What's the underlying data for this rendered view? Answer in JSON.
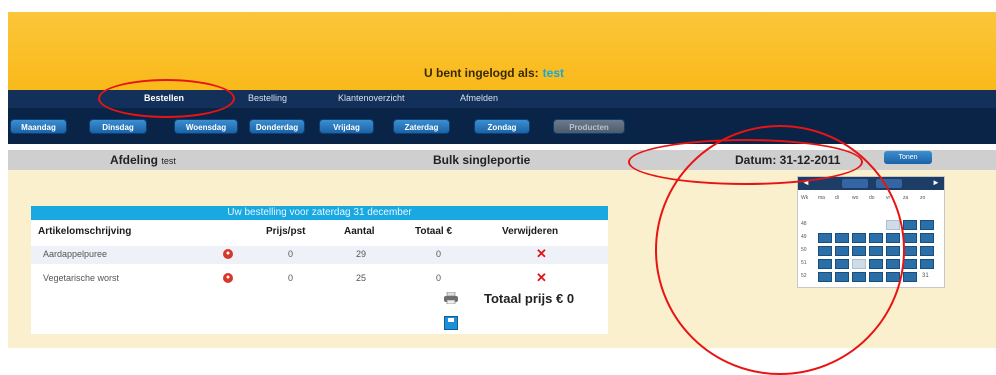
{
  "header": {
    "login_label": "U bent ingelogd als:",
    "username": "test"
  },
  "nav": {
    "items": [
      "Bestellen",
      "Bestelling",
      "Klantenoverzicht",
      "Afmelden"
    ]
  },
  "days": {
    "items": [
      "Maandag",
      "Dinsdag",
      "Woensdag",
      "Donderdag",
      "Vrijdag",
      "Zaterdag",
      "Zondag",
      "Producten"
    ]
  },
  "infobar": {
    "afdeling_label": "Afdeling",
    "afdeling_value": "test",
    "bulk_label": "Bulk singleportie",
    "datum_label": "Datum: 31-12-2011",
    "show_button": "Tonen"
  },
  "order": {
    "title": "Uw bestelling voor zaterdag 31 december",
    "columns": [
      "Artikelomschrijving",
      "Prijs/pst",
      "Aantal",
      "Totaal €",
      "Verwijderen"
    ],
    "rows": [
      {
        "name": "Aardappelpuree",
        "price": "0",
        "qty": "29",
        "total": "0"
      },
      {
        "name": "Vegetarische worst",
        "price": "0",
        "qty": "25",
        "total": "0"
      }
    ],
    "total_label": "Totaal prijs € 0"
  },
  "calendar": {
    "prev": "◄",
    "next": "►",
    "weekdays": [
      "Wk",
      "ma",
      "di",
      "wo",
      "do",
      "vr",
      "za",
      "zo"
    ],
    "weeks": [
      "48",
      "49",
      "50",
      "51",
      "52"
    ],
    "today": "31"
  },
  "colors": {
    "header": "#f9b91a",
    "nav": "#13305a",
    "accent": "#19a8e0",
    "delete": "#e01515",
    "annotation": "#e81414"
  },
  "icons": [
    "info-dot-icon",
    "delete-x-icon",
    "print-icon",
    "save-icon",
    "calendar-prev-icon",
    "calendar-next-icon"
  ]
}
